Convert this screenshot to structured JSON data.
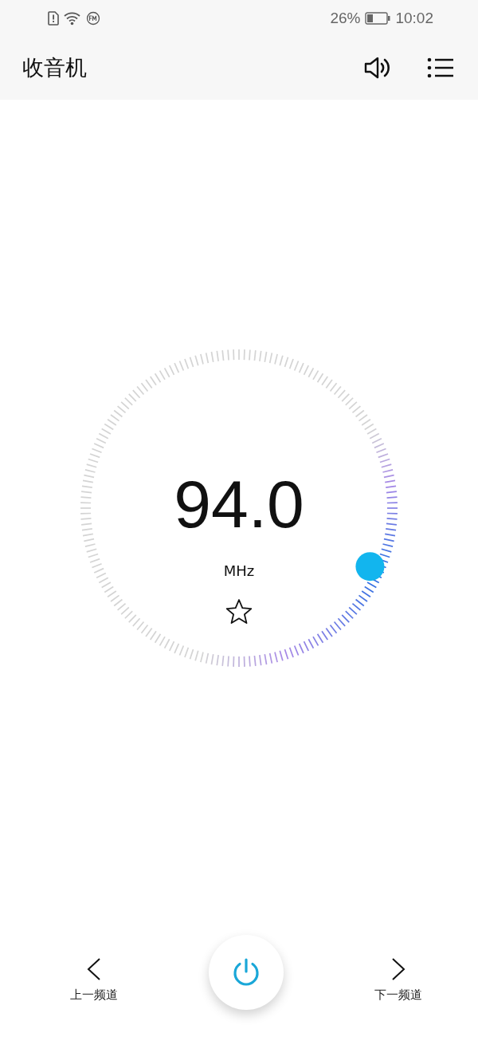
{
  "status_bar": {
    "battery": "26%",
    "time": "10:02"
  },
  "app_bar": {
    "title": "收音机"
  },
  "tuner": {
    "frequency": "94.0",
    "unit": "MHz",
    "favorite": false
  },
  "controls": {
    "previous": "上一频道",
    "next": "下一频道",
    "power_on": true
  }
}
